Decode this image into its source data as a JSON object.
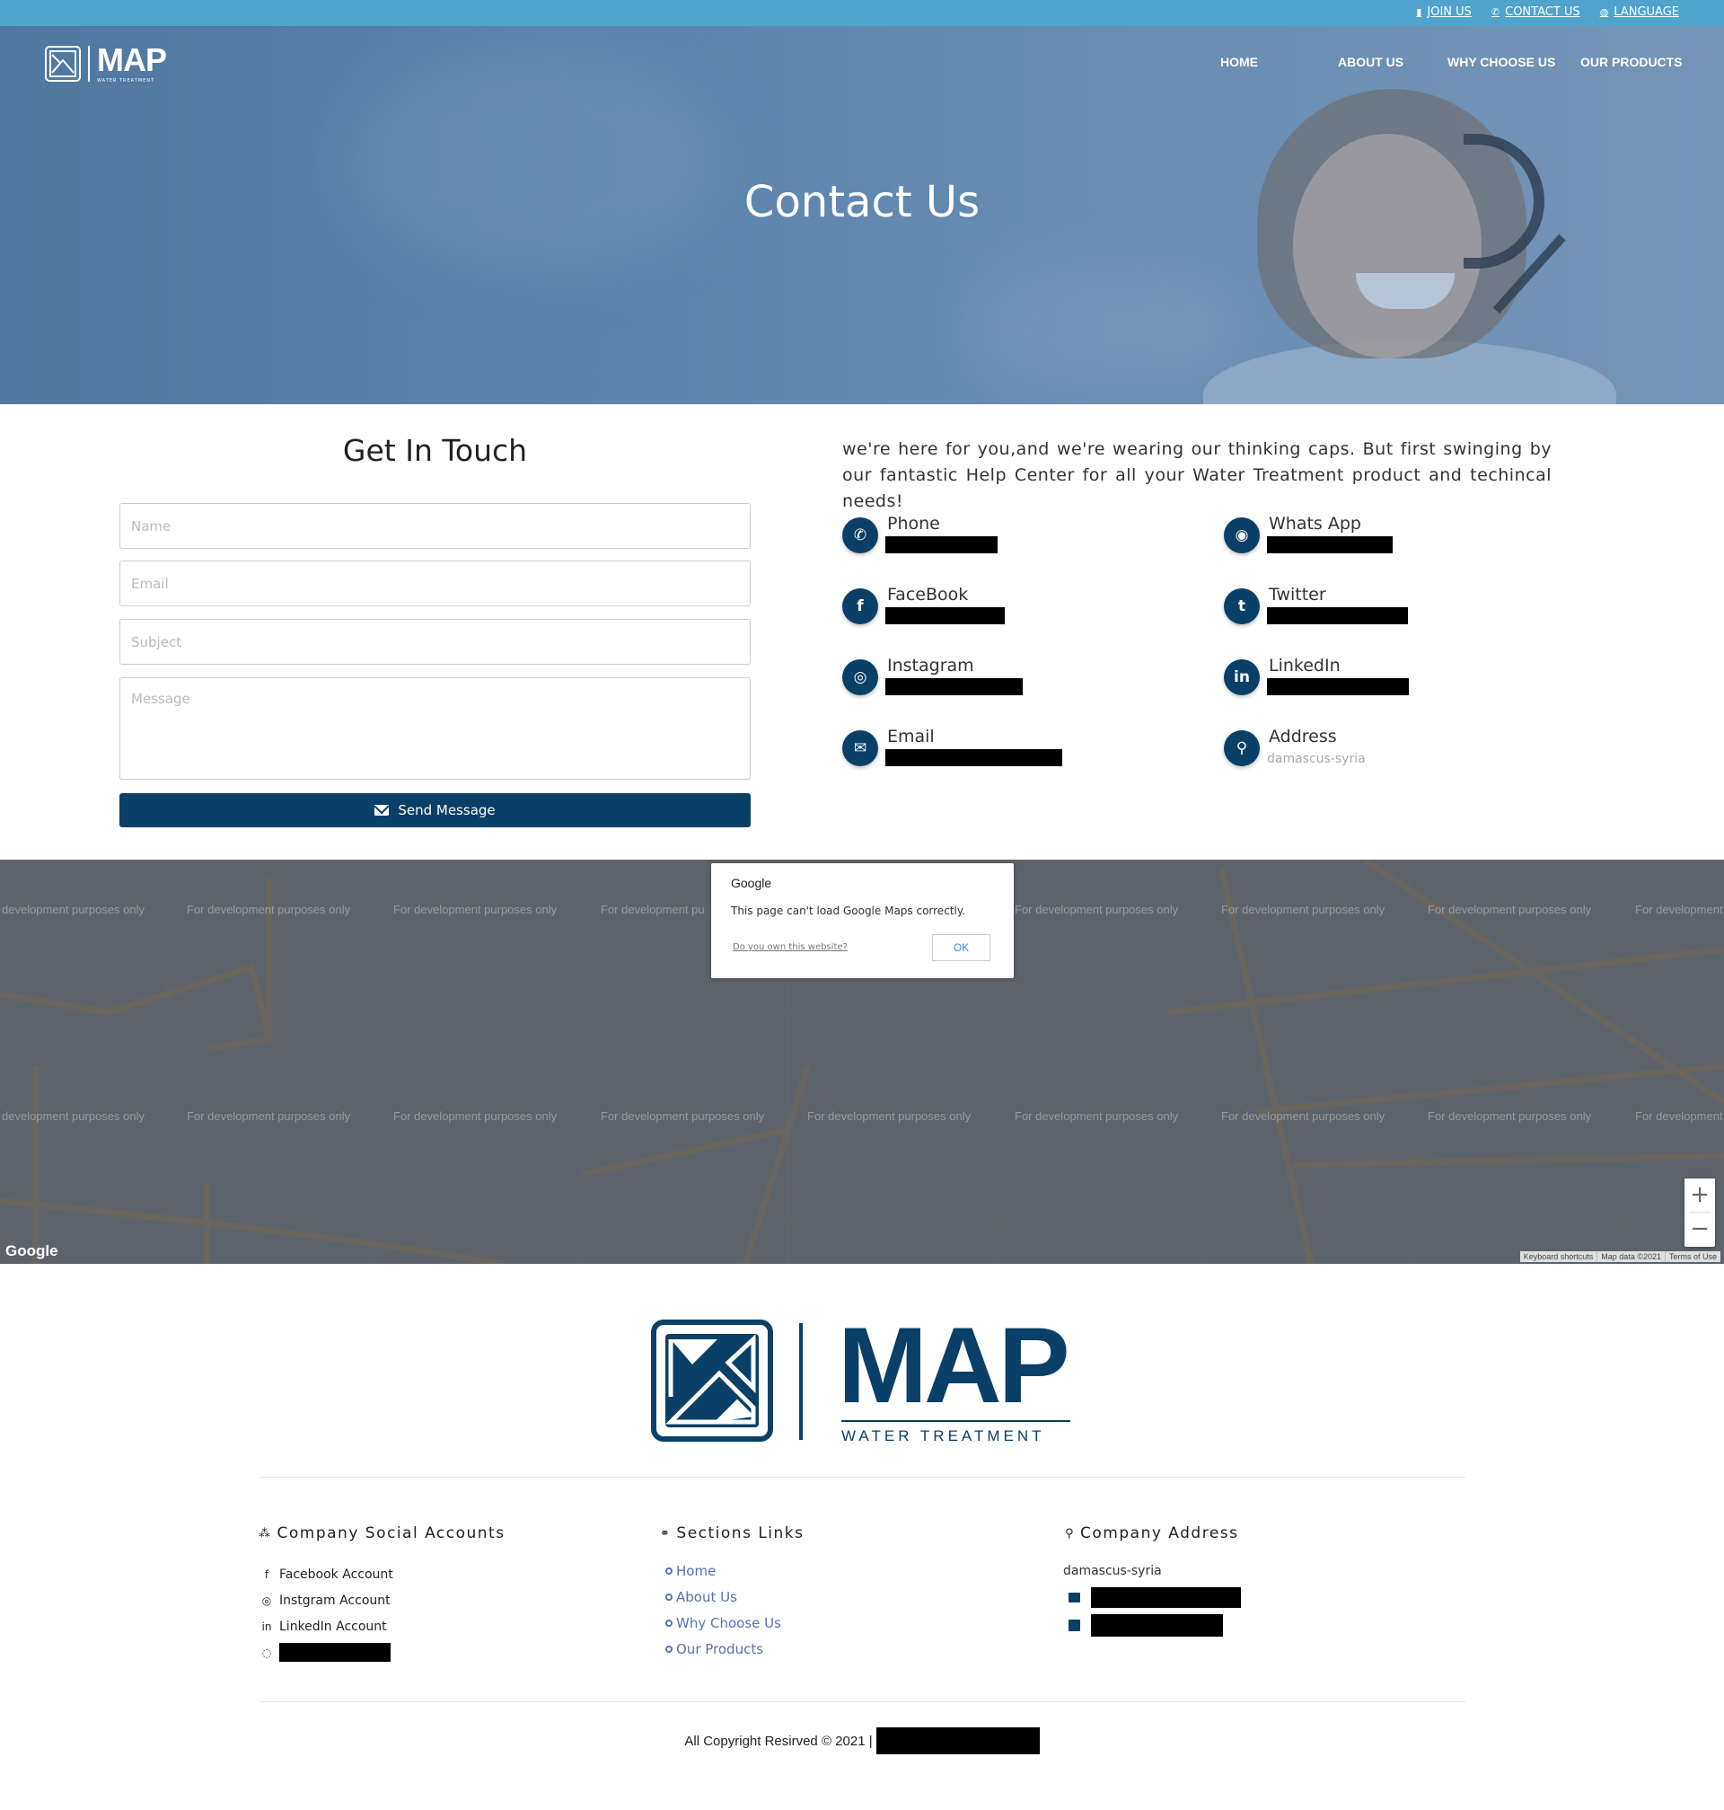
{
  "topbar": {
    "links": [
      {
        "label": "JOIN US",
        "icon": "briefcase-icon"
      },
      {
        "label": "CONTACT US",
        "icon": "phone-icon"
      },
      {
        "label": "LANGUAGE",
        "icon": "globe-icon"
      }
    ]
  },
  "logo": {
    "word": "MAP",
    "sub": "WATER TREATMENT"
  },
  "nav": {
    "items": [
      "HOME",
      "ABOUT US",
      "WHY CHOOSE US",
      "OUR PRODUCTS"
    ]
  },
  "hero": {
    "title": "Contact Us"
  },
  "form": {
    "title": "Get In Touch",
    "name_placeholder": "Name",
    "email_placeholder": "Email",
    "subject_placeholder": "Subject",
    "message_placeholder": "Message",
    "send_label": "Send Message"
  },
  "contact_info": {
    "intro": "we're here for you,and we're wearing our thinking caps. But first swinging by our fantastic Help Center for all your Water Treatment product and techincal needs!",
    "items": [
      {
        "label": "Phone",
        "icon": "phone-icon"
      },
      {
        "label": "Whats App",
        "icon": "whatsapp-icon"
      },
      {
        "label": "FaceBook",
        "icon": "facebook-icon"
      },
      {
        "label": "Twitter",
        "icon": "twitter-icon"
      },
      {
        "label": "Instagram",
        "icon": "instagram-icon"
      },
      {
        "label": "LinkedIn",
        "icon": "linkedin-icon"
      },
      {
        "label": "Email",
        "icon": "envelope-icon"
      },
      {
        "label": "Address",
        "icon": "map-pin-icon",
        "value": "damascus-syria"
      }
    ]
  },
  "map": {
    "watermark": "For development purposes only",
    "watermark_cut_left": "development purposes only",
    "watermark_cut_right": "For development",
    "watermark_cut_mid": "For development pu",
    "dialog": {
      "title": "Google",
      "message": "This page can't load Google Maps correctly.",
      "link": "Do you own this website?",
      "ok": "OK"
    },
    "zoom_in": "+",
    "zoom_out": "−",
    "google_label": "Google",
    "attribution": [
      "Keyboard shortcuts",
      "Map data ©2021",
      "Terms of Use"
    ]
  },
  "footer": {
    "social_title": "Company Social Accounts",
    "social": [
      {
        "label": "Facebook Account",
        "icon": "facebook-icon"
      },
      {
        "label": "Instgram Account",
        "icon": "instagram-icon"
      },
      {
        "label": "LinkedIn Account",
        "icon": "linkedin-icon"
      },
      {
        "label": "",
        "icon": "whatsapp-icon"
      }
    ],
    "links_title": "Sections Links",
    "links": [
      "Home",
      "About Us",
      "Why Choose Us",
      "Our Products"
    ],
    "address_title": "Company Address",
    "address": "damascus-syria",
    "copyright": "All Copyright Resirved © 2021 |"
  }
}
